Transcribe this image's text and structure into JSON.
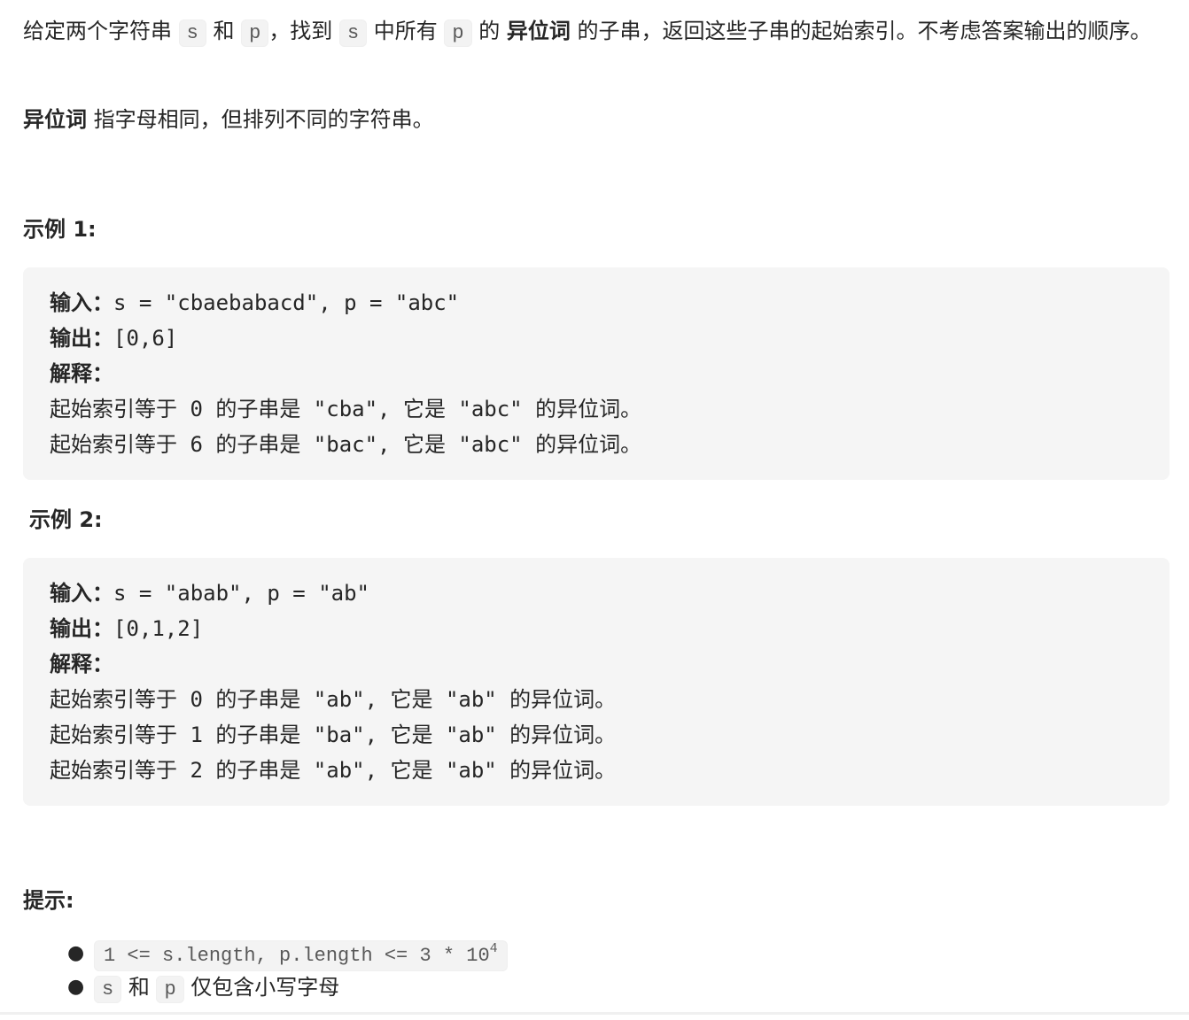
{
  "description": {
    "intro_parts": [
      "给定两个字符串 ",
      "s",
      " 和 ",
      "p",
      "，找到 ",
      "s",
      " 中所有 ",
      "p",
      " 的 ",
      "异位词",
      " 的子串，返回这些子串的起始索引。不考虑答案输出的顺序。"
    ],
    "definition_term": "异位词",
    "definition_text": " 指字母相同，但排列不同的字符串。"
  },
  "examples": [
    {
      "heading": "示例 1:",
      "input_label": "输入：",
      "input_value": "s = \"cbaebabacd\", p = \"abc\"",
      "output_label": "输出：",
      "output_value": "[0,6]",
      "explain_label": "解释：",
      "explanations": [
        "起始索引等于 0 的子串是 \"cba\", 它是 \"abc\" 的异位词。",
        "起始索引等于 6 的子串是 \"bac\", 它是 \"abc\" 的异位词。"
      ]
    },
    {
      "heading": "示例 2:",
      "input_label": "输入：",
      "input_value": "s = \"abab\", p = \"ab\"",
      "output_label": "输出：",
      "output_value": "[0,1,2]",
      "explain_label": "解释：",
      "explanations": [
        "起始索引等于 0 的子串是 \"ab\", 它是 \"ab\" 的异位词。",
        "起始索引等于 1 的子串是 \"ba\", 它是 \"ab\" 的异位词。",
        "起始索引等于 2 的子串是 \"ab\", 它是 \"ab\" 的异位词。"
      ]
    }
  ],
  "hints": {
    "heading": "提示:",
    "items": [
      {
        "code": "1 <= s.length, p.length <= 3 * 10",
        "sup": "4"
      },
      {
        "code_s": "s",
        "and": " 和 ",
        "code_p": "p",
        "text": " 仅包含小写字母"
      }
    ]
  }
}
